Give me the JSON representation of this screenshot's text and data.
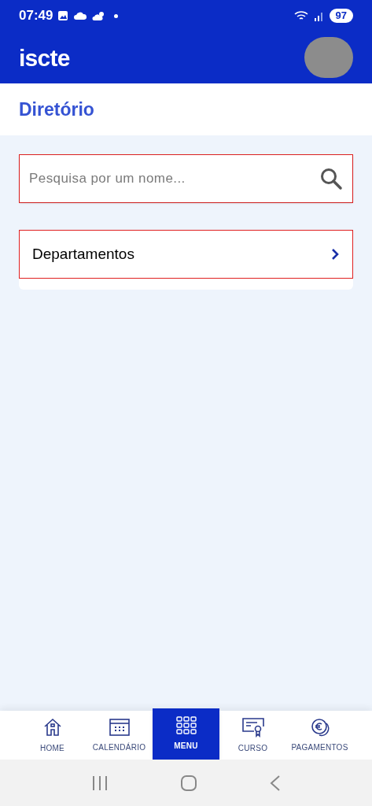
{
  "status_bar": {
    "time": "07:49",
    "battery": "97"
  },
  "header": {
    "logo": "iscte"
  },
  "page_title": "Diretório",
  "search": {
    "placeholder": "Pesquisa por um nome..."
  },
  "items": [
    {
      "label": "Departamentos"
    }
  ],
  "nav": [
    {
      "kind": "home",
      "label": "HOME",
      "selected": false
    },
    {
      "kind": "calendar",
      "label": "CALENDÁRIO",
      "selected": false
    },
    {
      "kind": "menu",
      "label": "MENU",
      "selected": true
    },
    {
      "kind": "course",
      "label": "CURSO",
      "selected": false
    },
    {
      "kind": "payments",
      "label": "PAGAMENTOS",
      "selected": false
    }
  ]
}
